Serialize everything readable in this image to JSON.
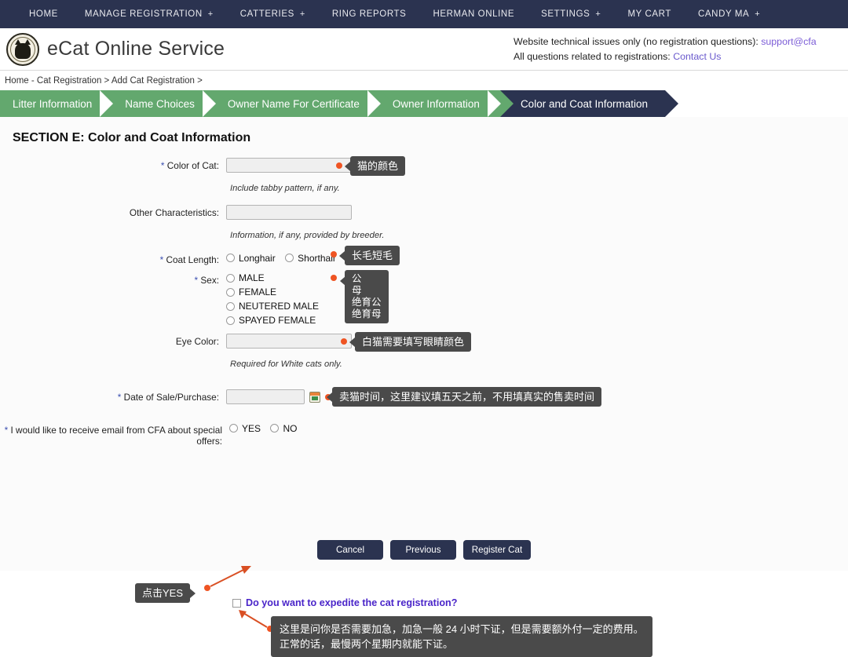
{
  "topnav": {
    "items": [
      {
        "label": "HOME",
        "has_plus": false
      },
      {
        "label": "MANAGE REGISTRATION",
        "has_plus": true
      },
      {
        "label": "CATTERIES",
        "has_plus": true
      },
      {
        "label": "RING REPORTS",
        "has_plus": false
      },
      {
        "label": "HERMAN ONLINE",
        "has_plus": false
      },
      {
        "label": "SETTINGS",
        "has_plus": true
      },
      {
        "label": "MY CART",
        "has_plus": false
      },
      {
        "label": "CANDY MA",
        "has_plus": true
      }
    ],
    "plus_glyph": "+"
  },
  "header": {
    "brand": "eCat Online Service",
    "support_line1_text": "Website technical issues only (no registration questions): ",
    "support_line1_link": "support@cfa",
    "support_line2_text": "All questions related to registrations: ",
    "support_line2_link": "Contact Us"
  },
  "breadcrumb": "Home - Cat Registration > Add Cat Registration >",
  "wizard": {
    "steps": [
      {
        "label": "Litter Information",
        "active": false
      },
      {
        "label": "Name Choices",
        "active": false
      },
      {
        "label": "Owner Name For Certificate",
        "active": false
      },
      {
        "label": "Owner Information",
        "active": false
      },
      {
        "label": "Color and Coat Information",
        "active": true
      }
    ],
    "active_color": "#2b3350",
    "step_color": "#63a86e"
  },
  "form": {
    "section_title": "SECTION E: Color and Coat Information",
    "color_of_cat": {
      "label": "Color of Cat:",
      "required": true,
      "value": "",
      "hint": "Include tabby pattern, if any."
    },
    "other_characteristics": {
      "label": "Other Characteristics:",
      "required": false,
      "value": "",
      "hint": "Information, if any, provided by breeder."
    },
    "coat_length": {
      "label": "Coat Length:",
      "required": true,
      "options": [
        "Longhair",
        "Shorthair"
      ],
      "selected": ""
    },
    "sex": {
      "label": "Sex:",
      "required": true,
      "options": [
        "MALE",
        "FEMALE",
        "NEUTERED MALE",
        "SPAYED FEMALE"
      ],
      "selected": ""
    },
    "eye_color": {
      "label": "Eye Color:",
      "required": false,
      "value": "",
      "hint": "Required for White cats only."
    },
    "date_of_sale": {
      "label": "Date of Sale/Purchase:",
      "required": true,
      "value": "",
      "calendar_icon": "calendar-icon"
    },
    "email_offers": {
      "label": "I would like to receive email from CFA about special offers:",
      "required": true,
      "options": [
        "YES",
        "NO"
      ],
      "selected": ""
    },
    "expedite": {
      "label": "Do you want to expedite the cat registration?",
      "checked": false
    }
  },
  "annotations": {
    "color_of_cat": "猫的颜色",
    "coat_length": "长毛短毛",
    "sex": "公\n母\n绝育公\n绝育母",
    "eye_color": "白猫需要填写眼睛颜色",
    "date_of_sale": "卖猫时间，这里建议填五天之前，不用填真实的售卖时间",
    "email_offers": "点击YES",
    "expedite": "这里是问你是否需要加急，加急一般 24 小时下证，但是需要额外付一定的费用。\n正常的话，最慢两个星期内就能下证。",
    "marker_color": "#ef5423",
    "tooltip_bg": "#4a4a4a"
  },
  "buttons": {
    "cancel": "Cancel",
    "previous": "Previous",
    "register": "Register Cat"
  }
}
